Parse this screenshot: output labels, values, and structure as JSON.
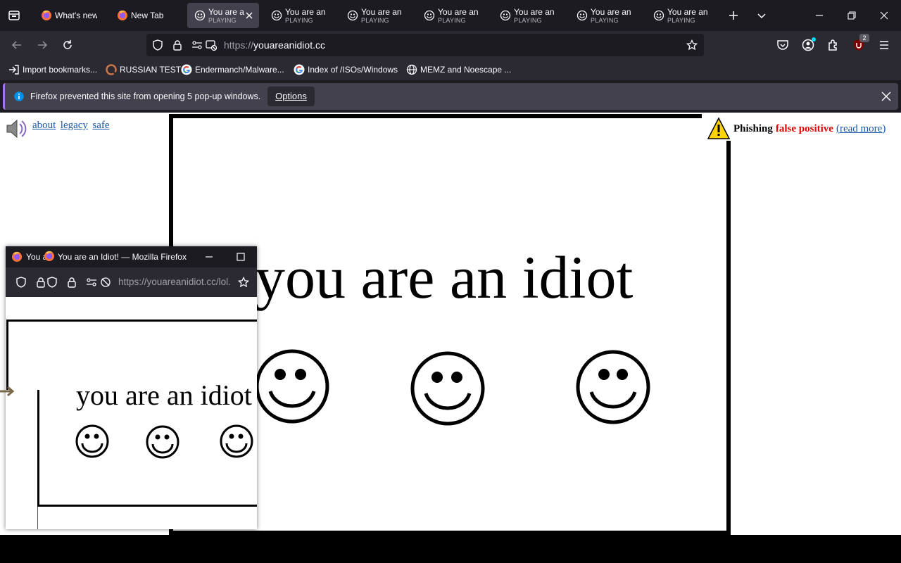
{
  "browser": {
    "tabs": [
      {
        "title": "What's new",
        "subtitle": "",
        "icon": "firefox-icon",
        "active": false
      },
      {
        "title": "New Tab",
        "subtitle": "",
        "icon": "firefox-icon",
        "active": false
      },
      {
        "title": "You are a",
        "subtitle": "PLAYING",
        "icon": "smiley-icon",
        "active": true
      },
      {
        "title": "You are an I",
        "subtitle": "PLAYING",
        "icon": "smiley-icon",
        "active": false
      },
      {
        "title": "You are an I",
        "subtitle": "PLAYING",
        "icon": "smiley-icon",
        "active": false
      },
      {
        "title": "You are an I",
        "subtitle": "PLAYING",
        "icon": "smiley-icon",
        "active": false
      },
      {
        "title": "You are an I",
        "subtitle": "PLAYING",
        "icon": "smiley-icon",
        "active": false
      },
      {
        "title": "You are an I",
        "subtitle": "PLAYING",
        "icon": "smiley-icon",
        "active": false
      },
      {
        "title": "You are an",
        "subtitle": "PLAYING",
        "icon": "smiley-icon",
        "active": false
      }
    ],
    "url_protocol": "https://",
    "url_host": "youareanidiot.cc",
    "extension_badge": "2",
    "bookmarks": [
      {
        "label": "Import bookmarks...",
        "icon": "import-icon"
      },
      {
        "label": "RUSSIAN TEST",
        "icon": "site-icon"
      },
      {
        "label": "Endermanch/Malware...",
        "icon": "google-icon"
      },
      {
        "label": "Index of /ISOs/Windows",
        "icon": "google-icon"
      },
      {
        "label": "MEMZ and Noescape ...",
        "icon": "globe-icon"
      }
    ]
  },
  "notification": {
    "message": "Firefox prevented this site from opening 5 pop-up windows.",
    "options_label": "Options"
  },
  "page": {
    "links": [
      "about",
      "legacy",
      "safe"
    ],
    "headline": "you are an idiot",
    "phishing_label": "Phishing",
    "phishing_status": "false positive",
    "phishing_link": "(read more)",
    "colors": {
      "link": "#1a57a7",
      "warning": "#e00000",
      "accent": "#a872f7"
    }
  },
  "popup": {
    "title_prefix": "You a",
    "title": "You are an Idiot! — Mozilla Firefox",
    "url": "https://youareanidiot.cc/lol.",
    "headline": "you are an idiot"
  }
}
